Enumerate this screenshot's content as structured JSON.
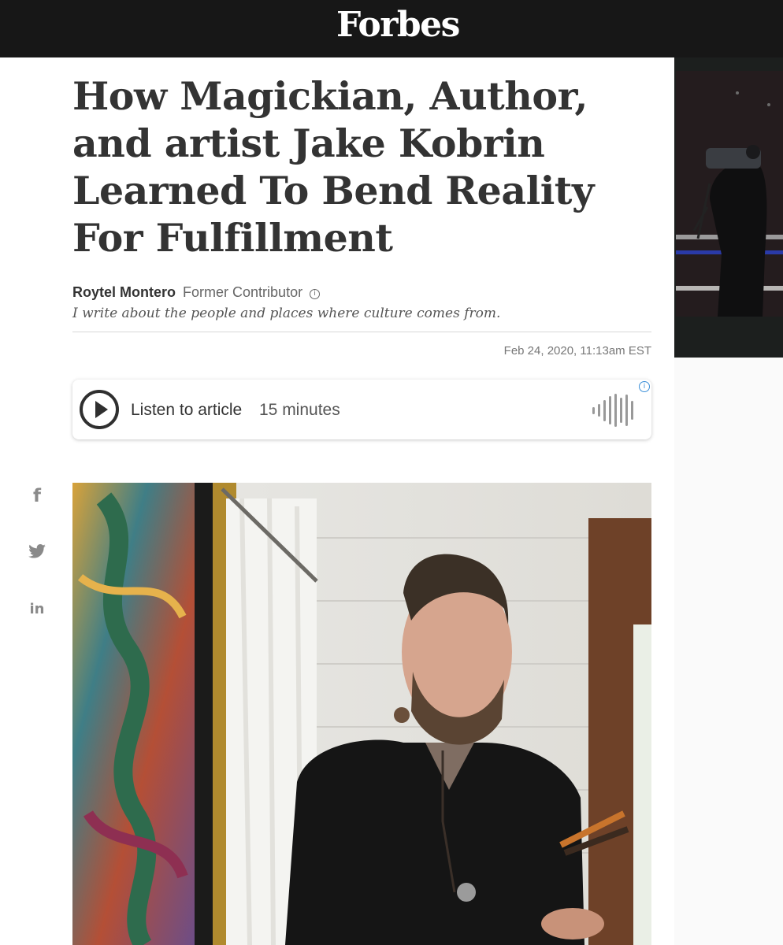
{
  "header": {
    "logo": "Forbes"
  },
  "article": {
    "headline": "How Magickian, Author, and artist Jake Kobrin Learned To Bend Reality For Fulfillment",
    "author": "Roytel Montero",
    "author_role": "Former Contributor",
    "tagline": "I write about the people and places where culture comes from.",
    "date": "Feb 24, 2020, 11:13am EST"
  },
  "audio": {
    "label": "Listen to article",
    "duration": "15 minutes"
  },
  "share": {
    "facebook_glyph": "f",
    "linkedin_glyph": "in"
  },
  "icons": [
    "info-icon",
    "play-icon",
    "waveform-icon",
    "facebook-icon",
    "twitter-icon",
    "linkedin-icon"
  ],
  "colors": {
    "topbar": "#171717",
    "text": "#333333",
    "muted": "#777777",
    "info_blue": "#3b8fd8"
  }
}
